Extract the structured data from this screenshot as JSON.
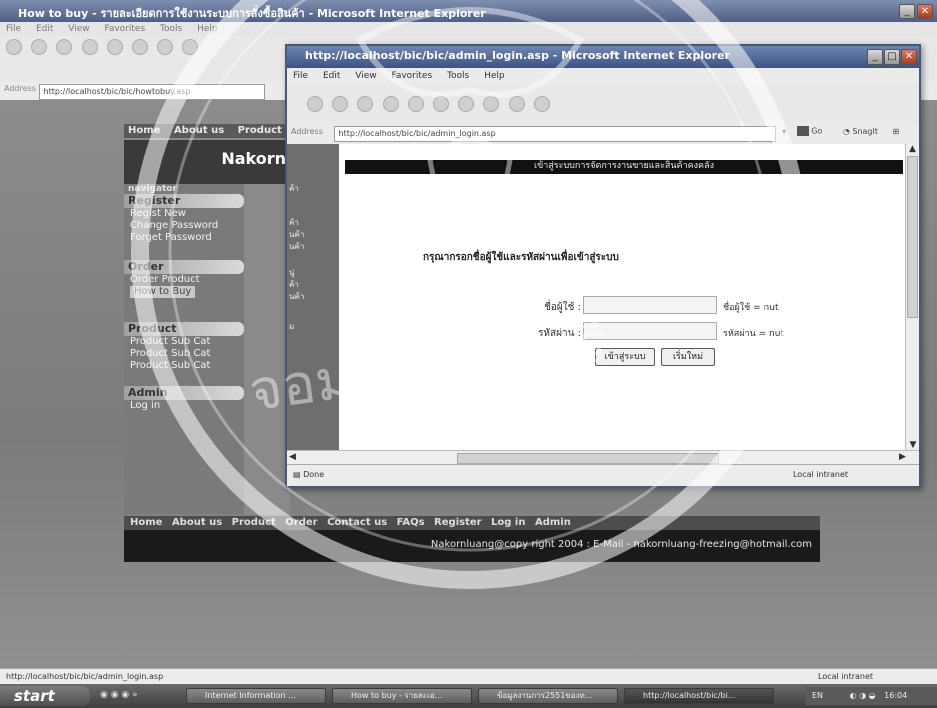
{
  "back_window": {
    "title": "How to buy - รายละเอียดการใช้งานระบบการสั่งซื้อสินค้า - Microsoft Internet Explorer",
    "menu": [
      "File",
      "Edit",
      "View",
      "Favorites",
      "Tools",
      "Help"
    ],
    "address_label": "Address",
    "address_url": "http://localhost/bic/bic/howtobuy.asp",
    "status_url": "http://localhost/bic/bic/admin_login.asp",
    "status_zone": "Local intranet"
  },
  "site": {
    "top_nav": [
      "Home",
      "About us",
      "Product"
    ],
    "banner_text": "Nakorn",
    "nav_caption": "navigator",
    "sections": [
      {
        "title": "Register",
        "items": [
          "Regist New",
          "Change Password",
          "Forget Password"
        ]
      },
      {
        "title": "Order",
        "items": [
          "Order Product",
          "How to Buy"
        ]
      },
      {
        "title": "Product",
        "items": [
          "Product Sub Cat",
          "Product Sub Cat",
          "Product Sub Cat"
        ]
      },
      {
        "title": "Admin",
        "items": [
          "Log in"
        ]
      }
    ],
    "mid_items": [
      "ค้า",
      "ค้า",
      "นค้า",
      "นค้า",
      "นู่",
      "ค้า",
      "นค้า",
      "ม"
    ],
    "footer_nav": [
      "Home",
      "About us",
      "Product",
      "Order",
      "Contact us",
      "FAQs",
      "Register",
      "Log in",
      "Admin"
    ],
    "copyright": "Nakornluang@copy right 2004 : E-Mail - nakornluang-freezing@hotmail.com"
  },
  "front_window": {
    "title": "http://localhost/bic/bic/admin_login.asp - Microsoft Internet Explorer",
    "menu": [
      "File",
      "Edit",
      "View",
      "Favorites",
      "Tools",
      "Help"
    ],
    "address_label": "Address",
    "address_url": "http://localhost/bic/bic/admin_login.asp",
    "go_label": "Go",
    "snagit_label": "SnagIt",
    "status_done": "Done",
    "status_zone": "Local intranet"
  },
  "login": {
    "header": "เข้าสู่ระบบการจัดการงานขายและสินค้าคงคลัง",
    "prompt": "กรุณากรอกชื่อผู้ใช้และรหัสผ่านเพื่อเข้าสู่ระบบ",
    "username_label": "ชื่อผู้ใช้ :",
    "username_hint": "ชื่อผู้ใช้ = nut",
    "password_label": "รหัสผ่าน :",
    "password_hint": "รหัสผ่าน = nut",
    "submit_label": "เข้าสู่ระบบ",
    "reset_label": "เริ่มใหม่"
  },
  "taskbar": {
    "start_label": "start",
    "tasks": [
      "Internet Information ...",
      "How to buy - รายละเอ...",
      "ข้อมูลงานการ2551ของท...",
      "http://localhost/bic/bi..."
    ],
    "lang": "EN",
    "clock": "16:04"
  },
  "watermark": {
    "text": "จอมเกล้าธนบุรี"
  }
}
